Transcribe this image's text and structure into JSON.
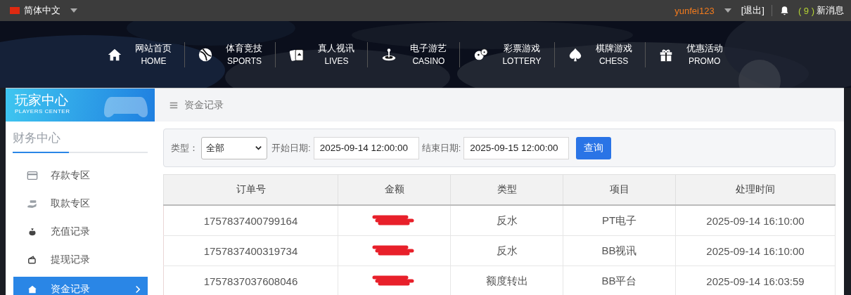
{
  "top_bar": {
    "language": "简体中文",
    "username": "yunfei123",
    "logout": "[退出]",
    "message_count": "( 9 )",
    "message_label": "新消息"
  },
  "nav": [
    {
      "title": "网站首页",
      "subtitle": "HOME"
    },
    {
      "title": "体育竞技",
      "subtitle": "SPORTS"
    },
    {
      "title": "真人视讯",
      "subtitle": "LIVES"
    },
    {
      "title": "电子游艺",
      "subtitle": "CASINO"
    },
    {
      "title": "彩票游戏",
      "subtitle": "LOTTERY"
    },
    {
      "title": "棋牌游戏",
      "subtitle": "CHESS"
    },
    {
      "title": "优惠活动",
      "subtitle": "PROMO"
    }
  ],
  "sidebar": {
    "title": "玩家中心",
    "subtitle": "PLAYERS CENTER",
    "section": "财务中心",
    "items": [
      {
        "label": "存款专区",
        "selected": false
      },
      {
        "label": "取款专区",
        "selected": false
      },
      {
        "label": "充值记录",
        "selected": false
      },
      {
        "label": "提现记录",
        "selected": false
      },
      {
        "label": "资金记录",
        "selected": true
      }
    ]
  },
  "breadcrumb": "资金记录",
  "filter": {
    "type_label": "类型：",
    "type_value": "全部",
    "start_label": "开始日期:",
    "start_value": "2025-09-14 12:00:00",
    "end_label": "结束日期:",
    "end_value": "2025-09-15 12:00:00",
    "query_button": "查询"
  },
  "table": {
    "columns": [
      "订单号",
      "金额",
      "类型",
      "项目",
      "处理时间"
    ],
    "rows": [
      {
        "order": "1757837400799164",
        "amount_redacted": true,
        "type": "反水",
        "item": "PT电子",
        "time": "2025-09-14 16:10:00"
      },
      {
        "order": "1757837400319734",
        "amount_redacted": true,
        "type": "反水",
        "item": "BB视讯",
        "time": "2025-09-14 16:10:00"
      },
      {
        "order": "1757837037608046",
        "amount_redacted": true,
        "type": "额度转出",
        "item": "BB平台",
        "time": "2025-09-14 16:03:59"
      }
    ]
  }
}
